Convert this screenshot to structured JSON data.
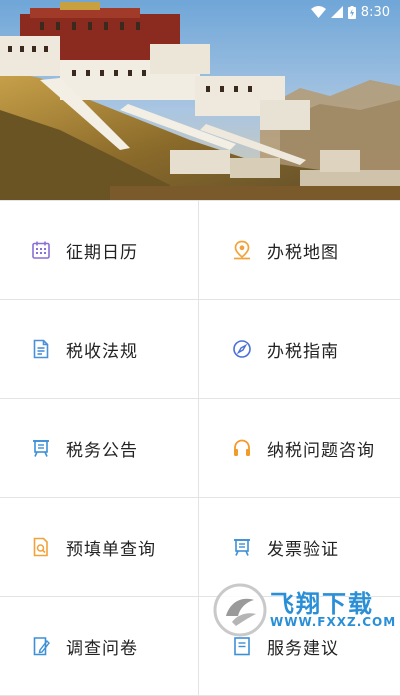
{
  "status_bar": {
    "time": "8:30",
    "icons": [
      "wifi-icon",
      "signal-icon",
      "battery-charging-icon"
    ]
  },
  "banner": {
    "image": "potala-palace-photo"
  },
  "menu": {
    "items": [
      {
        "label": "征期日历",
        "icon": "calendar-icon",
        "color": "#8a6fd6"
      },
      {
        "label": "办税地图",
        "icon": "map-pin-icon",
        "color": "#f2a23a"
      },
      {
        "label": "税收法规",
        "icon": "document-icon",
        "color": "#4a90d9"
      },
      {
        "label": "办税指南",
        "icon": "compass-icon",
        "color": "#4a6fd6"
      },
      {
        "label": "税务公告",
        "icon": "notice-board-icon",
        "color": "#3d8fd6"
      },
      {
        "label": "纳税问题咨询",
        "icon": "headphones-icon",
        "color": "#f29a2a"
      },
      {
        "label": "预填单查询",
        "icon": "search-document-icon",
        "color": "#f2a23a"
      },
      {
        "label": "发票验证",
        "icon": "invoice-icon",
        "color": "#3d8fd6"
      },
      {
        "label": "调查问卷",
        "icon": "survey-icon",
        "color": "#3d8fd6"
      },
      {
        "label": "服务建议",
        "icon": "suggestion-icon",
        "color": "#3d8fd6"
      }
    ]
  },
  "watermark": {
    "title": "飞翔下载",
    "url": "WWW.FXXZ.COM"
  }
}
